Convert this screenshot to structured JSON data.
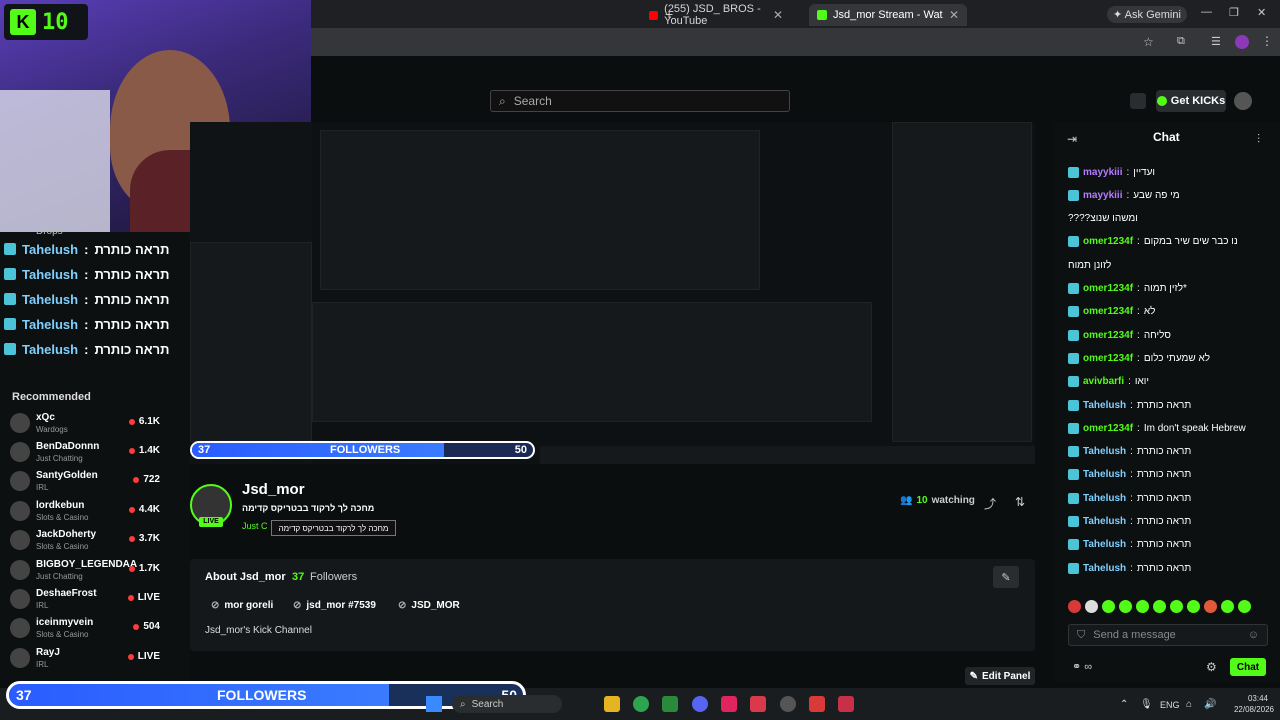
{
  "browser": {
    "tabs": [
      {
        "label": "(255) JSD_ BROS - YouTube"
      },
      {
        "label": "Jsd_mor Stream - Watch Live o"
      }
    ],
    "ask_gemini": "Ask Gemini"
  },
  "overlay": {
    "k_counter": "10",
    "followers": {
      "current": "37",
      "label": "FOLLOWERS",
      "goal": "50",
      "progress": 0.74
    }
  },
  "header": {
    "search_placeholder": "Search",
    "get_kicks": "Get KICKs"
  },
  "sidebar": {
    "chat_lines": [
      {
        "user": "Tahelush",
        "text": "תראה כותרת"
      },
      {
        "user": "Tahelush",
        "text": "תראה כותרת"
      },
      {
        "user": "Tahelush",
        "text": "תראה כותרת"
      },
      {
        "user": "Tahelush",
        "text": "תראה כותרת"
      },
      {
        "user": "Tahelush",
        "text": "תראה כותרת"
      }
    ],
    "drops_label": "Drops",
    "recommended_title": "Recommended",
    "recommended": [
      {
        "name": "xQc",
        "category": "Wardogs",
        "viewers": "6.1K"
      },
      {
        "name": "BenDaDonnn",
        "category": "Just Chatting",
        "viewers": "1.4K"
      },
      {
        "name": "SantyGolden",
        "category": "IRL",
        "viewers": "722"
      },
      {
        "name": "lordkebun",
        "category": "Slots & Casino",
        "viewers": "4.4K"
      },
      {
        "name": "JackDoherty",
        "category": "Slots & Casino",
        "viewers": "3.7K"
      },
      {
        "name": "BIGBOY_LEGENDAA",
        "category": "Just Chatting",
        "viewers": "1.7K"
      },
      {
        "name": "DeshaeFrost",
        "category": "IRL",
        "viewers": "LIVE"
      },
      {
        "name": "iceinmyvein",
        "category": "Slots & Casino",
        "viewers": "504"
      },
      {
        "name": "RayJ",
        "category": "IRL",
        "viewers": "LIVE"
      }
    ]
  },
  "channel": {
    "name": "Jsd_mor",
    "title": "מחכה לך לרקוד בבטריקס קדימה",
    "category": "Just C",
    "tooltip": "מחכה לך לרקוד בבטריקס קדימה",
    "live": "LIVE",
    "watching_count": "10",
    "watching_label": "watching",
    "about_title": "About Jsd_mor",
    "followers_count": "37",
    "followers_label": "Followers",
    "socials": [
      {
        "label": "mor goreli"
      },
      {
        "label": "jsd_mor #7539"
      },
      {
        "label": "JSD_MOR"
      }
    ],
    "description": "Jsd_mor's Kick Channel",
    "edit_panel": "Edit Panel"
  },
  "chat": {
    "title": "Chat",
    "messages": [
      {
        "user": "mayykiii",
        "text": "ועדיין",
        "color": "#b57cff"
      },
      {
        "user": "mayykiii",
        "text": "מי פה שבע",
        "color": "#b57cff"
      },
      {
        "user": "",
        "text": "????ומשהו שנוצ",
        "color": "#fff"
      },
      {
        "user": "omer1234f",
        "text": "נו כבר שים שיר במקום",
        "color": "#53fc18"
      },
      {
        "user": "",
        "text": "לזונן תמוח",
        "color": "#fff"
      },
      {
        "user": "omer1234f",
        "text": "לזין תמוה*",
        "color": "#53fc18"
      },
      {
        "user": "omer1234f",
        "text": "לא",
        "color": "#53fc18"
      },
      {
        "user": "omer1234f",
        "text": "סליחה",
        "color": "#53fc18"
      },
      {
        "user": "omer1234f",
        "text": "לא שמעתי כלום",
        "color": "#53fc18"
      },
      {
        "user": "avivbarfi",
        "text": "יואו",
        "color": "#53fc18"
      },
      {
        "user": "Tahelush",
        "text": "תראה כותרת",
        "color": "#7fd0ff"
      },
      {
        "user": "omer1234f",
        "text": "Im don't speak Hebrew",
        "color": "#53fc18"
      },
      {
        "user": "Tahelush",
        "text": "תראה כותרת",
        "color": "#7fd0ff"
      },
      {
        "user": "Tahelush",
        "text": "תראה כותרת",
        "color": "#7fd0ff"
      },
      {
        "user": "Tahelush",
        "text": "תראה כותרת",
        "color": "#7fd0ff"
      },
      {
        "user": "Tahelush",
        "text": "תראה כותרת",
        "color": "#7fd0ff"
      },
      {
        "user": "Tahelush",
        "text": "תראה כותרת",
        "color": "#7fd0ff"
      },
      {
        "user": "Tahelush",
        "text": "תראה כותרת",
        "color": "#7fd0ff"
      }
    ],
    "send_placeholder": "Send a message",
    "chat_button": "Chat"
  },
  "taskbar": {
    "search": "Search",
    "lang": "ENG",
    "time": "03:44",
    "date": "22/08/2026"
  },
  "colors": {
    "accent": "#53fc18",
    "followers_bar": "#2a5cff"
  }
}
